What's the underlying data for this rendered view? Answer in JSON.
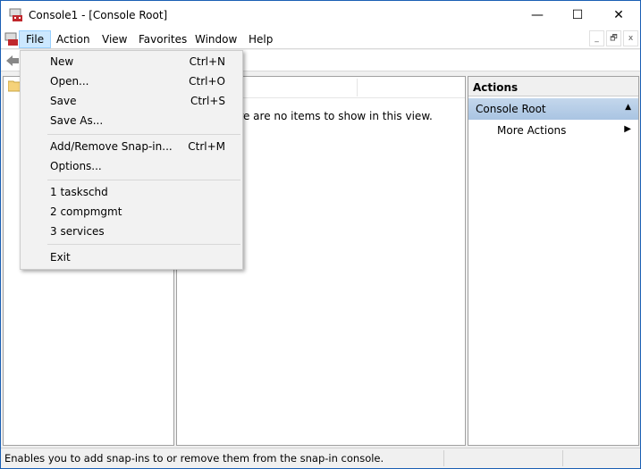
{
  "window": {
    "title": "Console1 - [Console Root]",
    "minimize": "—",
    "maximize": "☐",
    "close": "✕"
  },
  "menubar": {
    "items": [
      "File",
      "Action",
      "View",
      "Favorites",
      "Window",
      "Help"
    ],
    "mdi": [
      "_",
      "🗗",
      "x"
    ]
  },
  "left_pane": {
    "root_icon": "folder-icon"
  },
  "center_pane": {
    "empty_message": "There are no items to show in this view."
  },
  "actions_pane": {
    "header": "Actions",
    "section": "Console Root",
    "more_actions": "More Actions"
  },
  "file_menu": {
    "items": [
      {
        "label": "New",
        "shortcut": "Ctrl+N"
      },
      {
        "label": "Open...",
        "shortcut": "Ctrl+O"
      },
      {
        "label": "Save",
        "shortcut": "Ctrl+S"
      },
      {
        "label": "Save As...",
        "shortcut": ""
      },
      {
        "label": "Add/Remove Snap-in...",
        "shortcut": "Ctrl+M"
      },
      {
        "label": "Options...",
        "shortcut": ""
      },
      {
        "label": "1 taskschd",
        "shortcut": ""
      },
      {
        "label": "2 compmgmt",
        "shortcut": ""
      },
      {
        "label": "3 services",
        "shortcut": ""
      },
      {
        "label": "Exit",
        "shortcut": ""
      }
    ]
  },
  "status": {
    "text": "Enables you to add snap-ins to or remove them from the snap-in console."
  }
}
